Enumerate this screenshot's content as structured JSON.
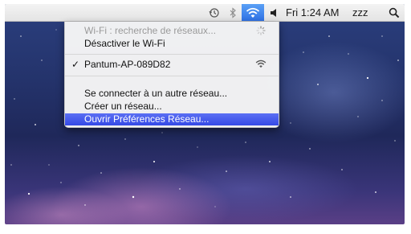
{
  "menubar": {
    "clock": "Fri 1:24 AM",
    "user": "zzz"
  },
  "wifi_menu": {
    "status": "Wi-Fi : recherche de réseaux...",
    "toggle": "Désactiver le Wi-Fi",
    "networks": [
      {
        "name": "Pantum-AP-089D82",
        "connected": true
      }
    ],
    "other_network": "Se connecter à un autre réseau...",
    "create_network": "Créer un réseau...",
    "open_preferences": "Ouvrir Préférences Réseau..."
  },
  "icons": {
    "time_machine": "time-machine-icon",
    "bluetooth": "bluetooth-icon",
    "wifi": "wifi-icon",
    "volume": "volume-icon",
    "spotlight": "spotlight-icon",
    "spinner": "spinner-icon",
    "signal": "wifi-signal-icon"
  },
  "colors": {
    "selection": "#3449e6",
    "wifi_highlight": "#2f72e6"
  }
}
